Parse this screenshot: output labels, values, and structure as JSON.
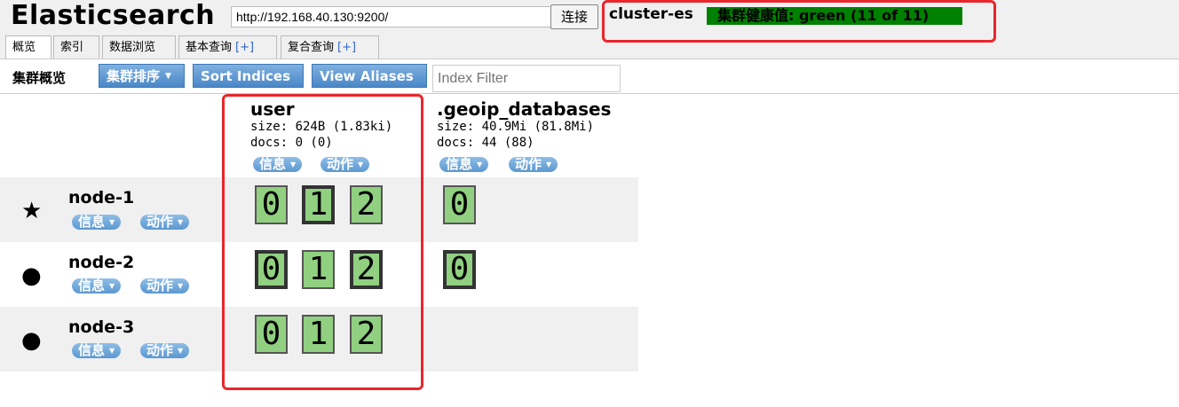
{
  "header": {
    "title": "Elasticsearch",
    "url": "http://192.168.40.130:9200/",
    "connect_label": "连接",
    "cluster_name": "cluster-es",
    "health": "集群健康值: green (11 of 11)"
  },
  "tabs": [
    {
      "label": "概览",
      "plus": ""
    },
    {
      "label": "索引",
      "plus": ""
    },
    {
      "label": "数据浏览",
      "plus": ""
    },
    {
      "label": "基本查询",
      "plus": "[+]"
    },
    {
      "label": "复合查询",
      "plus": "[+]"
    }
  ],
  "toolbar": {
    "title": "集群概览",
    "sort_cluster": "集群排序",
    "sort_indices": "Sort Indices",
    "view_aliases": "View Aliases",
    "filter_placeholder": "Index Filter"
  },
  "indices": [
    {
      "name": "user",
      "size": "size: 624B (1.83ki)",
      "docs": "docs: 0 (0)",
      "info": "信息",
      "action": "动作"
    },
    {
      "name": ".geoip_databases",
      "size": "size: 40.9Mi (81.8Mi)",
      "docs": "docs: 44 (88)",
      "info": "信息",
      "action": "动作"
    }
  ],
  "nodes": [
    {
      "name": "node-1",
      "icon": "star-icon",
      "info": "信息",
      "action": "动作",
      "user_shards": [
        {
          "n": "0",
          "primary": false
        },
        {
          "n": "1",
          "primary": true
        },
        {
          "n": "2",
          "primary": false
        }
      ],
      "geo_shards": [
        {
          "n": "0",
          "primary": false
        }
      ]
    },
    {
      "name": "node-2",
      "icon": "circle-icon",
      "info": "信息",
      "action": "动作",
      "user_shards": [
        {
          "n": "0",
          "primary": true
        },
        {
          "n": "1",
          "primary": false
        },
        {
          "n": "2",
          "primary": true
        }
      ],
      "geo_shards": [
        {
          "n": "0",
          "primary": true
        }
      ]
    },
    {
      "name": "node-3",
      "icon": "circle-icon",
      "info": "信息",
      "action": "动作",
      "user_shards": [
        {
          "n": "0",
          "primary": false
        },
        {
          "n": "1",
          "primary": false
        },
        {
          "n": "2",
          "primary": false
        }
      ],
      "geo_shards": []
    }
  ],
  "colors": {
    "health_green": "#008000",
    "shard_fill": "#90d080",
    "highlight_red": "#e8262c",
    "button_blue": "#5b98d0"
  }
}
